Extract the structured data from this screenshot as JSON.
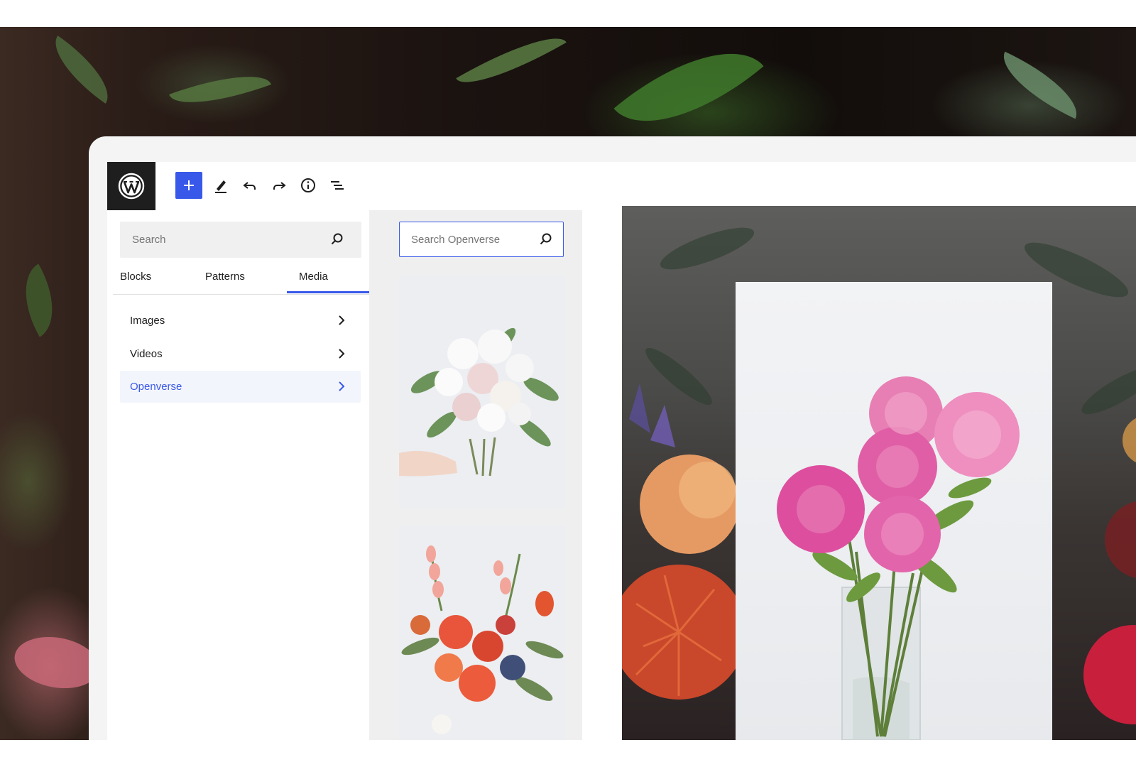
{
  "toolbar": {
    "logo_icon": "wordpress-logo",
    "add_icon": "plus-icon",
    "tools": [
      "edit-pen-icon",
      "undo-icon",
      "redo-icon",
      "info-icon",
      "list-view-icon"
    ],
    "accent": "#3858e9"
  },
  "inserter": {
    "search_placeholder": "Search",
    "tabs": [
      {
        "label": "Blocks"
      },
      {
        "label": "Patterns"
      },
      {
        "label": "Media",
        "active": true
      }
    ],
    "categories": [
      {
        "label": "Images"
      },
      {
        "label": "Videos"
      },
      {
        "label": "Openverse",
        "active": true
      }
    ]
  },
  "openverse": {
    "search_placeholder": "Search Openverse",
    "results": [
      "white-pink-rose-bouquet",
      "orange-red-flower-arrangement"
    ]
  },
  "canvas": {
    "image": "pink-peonies-in-glass-vase"
  }
}
